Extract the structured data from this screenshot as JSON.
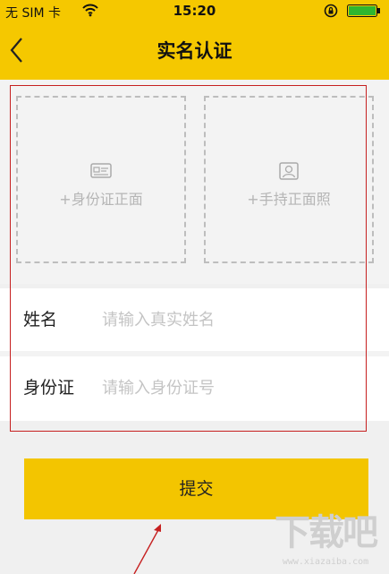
{
  "status_bar": {
    "carrier": "无 SIM 卡",
    "time": "15:20",
    "icons": [
      "wifi-icon",
      "rotation-lock-icon",
      "battery-icon"
    ]
  },
  "nav": {
    "title": "实名认证",
    "back_icon": "chevron-left-icon"
  },
  "upload": {
    "front_label": "+身份证正面",
    "front_icon": "id-card-icon",
    "hand_label": "+手持正面照",
    "hand_icon": "portrait-icon"
  },
  "form": {
    "name_label": "姓名",
    "name_placeholder": "请输入真实姓名",
    "name_value": "",
    "id_label": "身份证",
    "id_placeholder": "请输入身份证号",
    "id_value": ""
  },
  "submit_label": "提交",
  "watermark": {
    "text": "下载吧",
    "url": "www.xiazaiba.com"
  },
  "colors": {
    "brand_yellow": "#f5c800",
    "annotation_red": "#c62020",
    "placeholder_gray": "#c4c4c4"
  }
}
